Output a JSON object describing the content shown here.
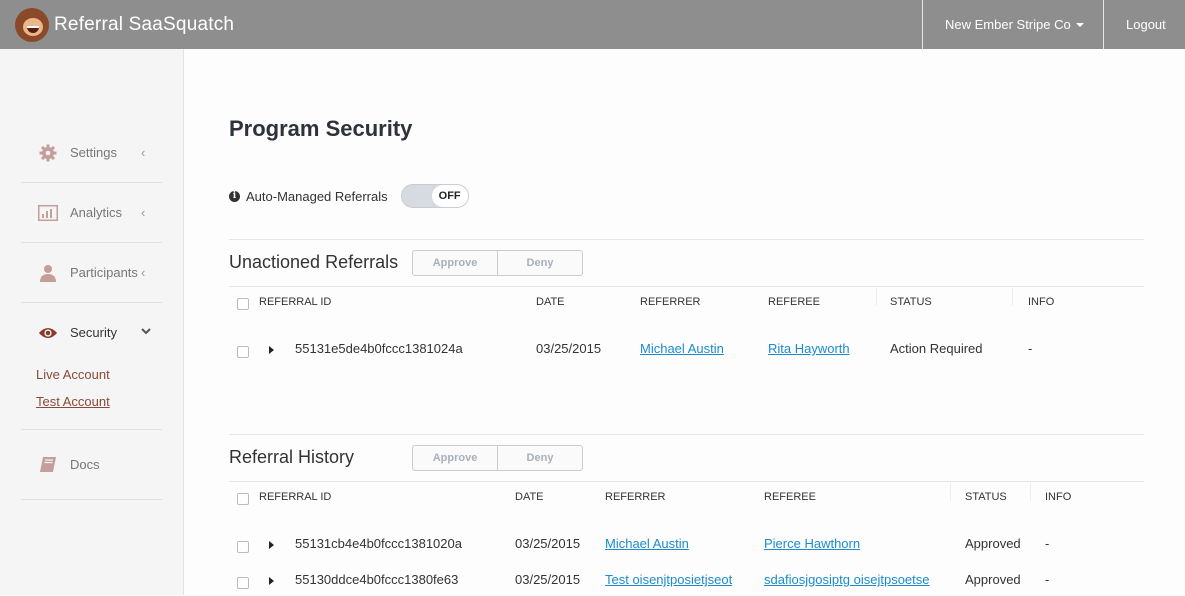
{
  "topbar": {
    "brand": "Referral SaaSquatch",
    "account_menu": "New Ember Stripe Co",
    "logout": "Logout"
  },
  "sidebar": {
    "items": [
      {
        "label": "Settings",
        "icon": "gear-icon",
        "chevron": "‹"
      },
      {
        "label": "Analytics",
        "icon": "bar-chart-icon",
        "chevron": "‹"
      },
      {
        "label": "Participants",
        "icon": "user-icon",
        "chevron": "‹"
      },
      {
        "label": "Security",
        "icon": "eye-icon",
        "chevron": "⌄"
      },
      {
        "label": "Docs",
        "icon": "book-icon"
      }
    ],
    "security_sub": [
      {
        "label": "Live Account"
      },
      {
        "label": "Test Account",
        "active": true
      }
    ]
  },
  "main": {
    "title": "Program Security",
    "auto_managed": {
      "label": "Auto-Managed Referrals",
      "toggle": "OFF"
    },
    "unactioned": {
      "title": "Unactioned Referrals",
      "approve": "Approve",
      "deny": "Deny",
      "columns": [
        "Referral ID",
        "Date",
        "Referrer",
        "Referee",
        "Status",
        "Info"
      ],
      "rows": [
        {
          "id": "55131e5de4b0fccc1381024a",
          "date": "03/25/2015",
          "referrer": "Michael Austin",
          "referee": "Rita Hayworth",
          "status": "Action Required",
          "info": "-"
        }
      ]
    },
    "history": {
      "title": "Referral History",
      "approve": "Approve",
      "deny": "Deny",
      "columns": [
        "Referral ID",
        "Date",
        "Referrer",
        "Referee",
        "Status",
        "Info"
      ],
      "rows": [
        {
          "id": "55131cb4e4b0fccc1381020a",
          "date": "03/25/2015",
          "referrer": "Michael Austin",
          "referee": "Pierce Hawthorn",
          "status": "Approved",
          "info": "-"
        },
        {
          "id": "55130ddce4b0fccc1380fe63",
          "date": "03/25/2015",
          "referrer": "Test oisenjtposietjseot",
          "referee": "sdafiosjgosiptg oisejtpsoetse",
          "status": "Approved",
          "info": "-"
        }
      ]
    }
  }
}
